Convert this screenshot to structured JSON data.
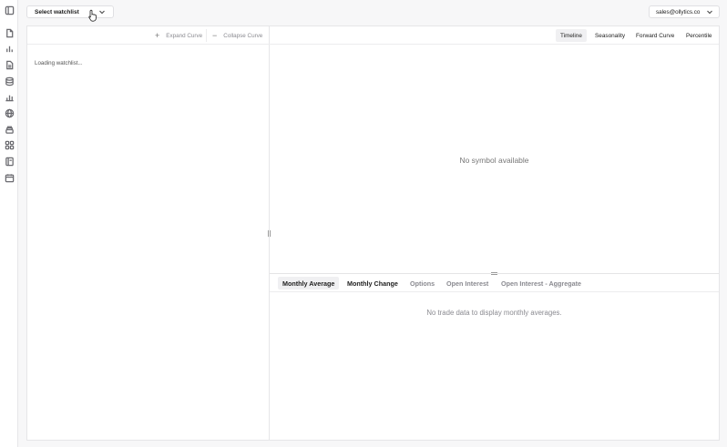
{
  "topbar": {
    "watchlist_label": "Select watchlist",
    "account_label": "sales@ollytics.co"
  },
  "sidebar": {
    "icons": [
      "file-icon",
      "bar-chart-icon",
      "document-icon",
      "database-icon",
      "analytics-icon",
      "globe-icon",
      "stack-icon",
      "grid-icon",
      "notebook-icon",
      "calendar-icon"
    ]
  },
  "left_panel": {
    "expand_label": "Expand Curve",
    "collapse_label": "Collapse Curve",
    "status": "Loading watchlist..."
  },
  "view_tabs": [
    {
      "label": "Timeline",
      "active": true
    },
    {
      "label": "Seasonality",
      "active": false
    },
    {
      "label": "Forward Curve",
      "active": false
    },
    {
      "label": "Percentile",
      "active": false
    }
  ],
  "chart_area": {
    "empty_message": "No symbol available"
  },
  "bottom_tabs": [
    {
      "label": "Monthly Average",
      "active": true
    },
    {
      "label": "Monthly Change",
      "active": false
    },
    {
      "label": "Options",
      "active": false
    },
    {
      "label": "Open Interest",
      "active": false
    },
    {
      "label": "Open Interest - Aggregate",
      "active": false
    }
  ],
  "bottom_panel": {
    "empty_message": "No trade data to display monthly averages."
  }
}
